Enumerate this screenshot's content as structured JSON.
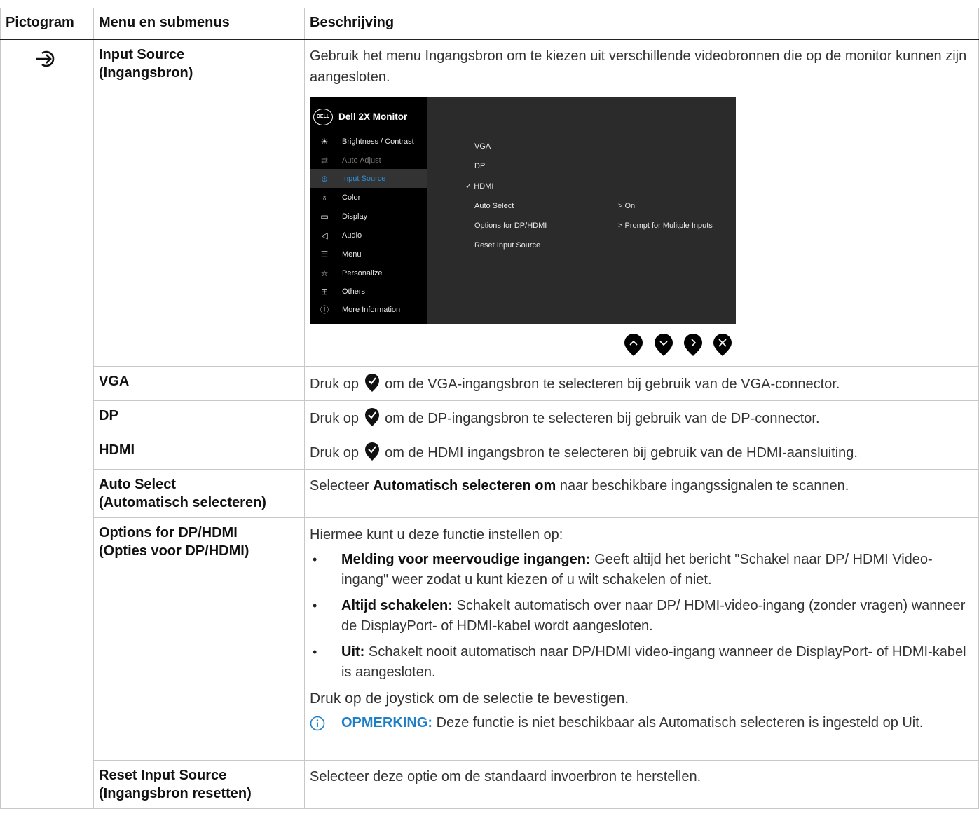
{
  "table": {
    "headers": [
      "Pictogram",
      "Menu en submenus",
      "Beschrijving"
    ]
  },
  "rows": {
    "input_source": {
      "menu_line1": "Input Source",
      "menu_line2": "(Ingangsbron)",
      "description": "Gebruik het menu Ingangsbron om te kiezen uit verschillende videobronnen die op de monitor kunnen zijn aangesloten."
    },
    "vga": {
      "menu": "VGA",
      "pre": "Druk op",
      "post": "om de VGA-ingangsbron te selecteren bij gebruik van de VGA-connector."
    },
    "dp": {
      "menu": "DP",
      "pre": "Druk op",
      "post": "om de DP-ingangsbron te selecteren bij gebruik van de DP-connector."
    },
    "hdmi": {
      "menu": "HDMI",
      "pre": "Druk op",
      "post": "om de HDMI ingangsbron te selecteren bij gebruik van de HDMI-aansluiting."
    },
    "auto_select": {
      "menu_line1": "Auto Select",
      "menu_line2": "(Automatisch selecteren)",
      "pre": "Selecteer",
      "bold": "Automatisch selecteren om",
      "post": "naar beschikbare ingangssignalen te scannen."
    },
    "options": {
      "menu_line1": "Options for DP/HDMI",
      "menu_line2": "(Opties voor DP/HDMI)",
      "intro": "Hiermee kunt u deze functie instellen op:",
      "bullets": [
        {
          "bold": "Melding voor meervoudige ingangen:",
          "text": "Geeft altijd het bericht \"Schakel naar DP/ HDMI Video-ingang\" weer zodat u kunt kiezen of u wilt schakelen of niet."
        },
        {
          "bold": "Altijd schakelen:",
          "text": "Schakelt automatisch over naar DP/ HDMI-video-ingang (zonder vragen) wanneer de DisplayPort- of HDMI-kabel wordt aangesloten."
        },
        {
          "bold": "Uit:",
          "text": "Schakelt nooit automatisch naar DP/HDMI video-ingang wanneer de DisplayPort- of HDMI-kabel is aangesloten."
        }
      ],
      "confirm": "Druk op de joystick om de selectie te bevestigen.",
      "note_label": "OPMERKING:",
      "note_text": "Deze functie is niet beschikbaar als Automatisch selecteren is ingesteld op Uit."
    },
    "reset": {
      "menu_line1": "Reset Input Source",
      "menu_line2": "(Ingangsbron resetten)",
      "description": "Selecteer deze optie om de standaard invoerbron te herstellen."
    }
  },
  "osd": {
    "logo": "DELL",
    "title": "Dell 2X Monitor",
    "menu": [
      {
        "label": "Brightness / Contrast",
        "icon": "brightness-icon",
        "state": "normal"
      },
      {
        "label": "Auto Adjust",
        "icon": "auto-adjust-icon",
        "state": "disabled"
      },
      {
        "label": "Input Source",
        "icon": "input-source-icon",
        "state": "selected"
      },
      {
        "label": "Color",
        "icon": "color-icon",
        "state": "normal"
      },
      {
        "label": "Display",
        "icon": "display-icon",
        "state": "normal"
      },
      {
        "label": "Audio",
        "icon": "audio-icon",
        "state": "normal"
      },
      {
        "label": "Menu",
        "icon": "menu-icon",
        "state": "normal"
      },
      {
        "label": "Personalize",
        "icon": "star-icon",
        "state": "normal"
      },
      {
        "label": "Others",
        "icon": "others-icon",
        "state": "normal"
      },
      {
        "label": "More Information",
        "icon": "info-icon",
        "state": "normal"
      }
    ],
    "options": [
      "VGA",
      "DP",
      "HDMI",
      "Auto Select",
      "Options for DP/HDMI",
      "Reset Input Source"
    ],
    "checkmark": "✓",
    "selected_option": "HDMI",
    "auto_select_value": "> On",
    "options_value": "> Prompt for Mulitple Inputs"
  },
  "colors": {
    "note_blue": "#1e7fc9",
    "osd_selected": "#2f8fd8",
    "osd_bg": "#2b2b2b"
  }
}
